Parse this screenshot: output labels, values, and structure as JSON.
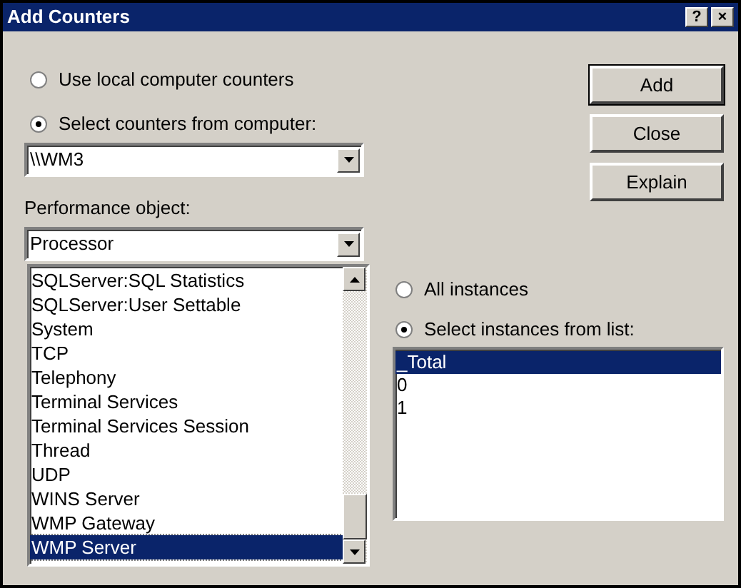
{
  "window": {
    "title": "Add Counters",
    "title_buttons": [
      "?",
      "×"
    ]
  },
  "source_options": [
    {
      "label": "Use local computer counters",
      "selected": false
    },
    {
      "label": "Select counters from computer:",
      "selected": true
    }
  ],
  "computer": {
    "value": "\\\\WM3"
  },
  "performance_object": {
    "label": "Performance object:",
    "value": "Processor"
  },
  "object_list": [
    {
      "label": "SQLServer:SQL Statistics",
      "selected": false
    },
    {
      "label": "SQLServer:User Settable",
      "selected": false
    },
    {
      "label": "System",
      "selected": false
    },
    {
      "label": "TCP",
      "selected": false
    },
    {
      "label": "Telephony",
      "selected": false
    },
    {
      "label": "Terminal Services",
      "selected": false
    },
    {
      "label": "Terminal Services Session",
      "selected": false
    },
    {
      "label": "Thread",
      "selected": false
    },
    {
      "label": "UDP",
      "selected": false
    },
    {
      "label": "WINS Server",
      "selected": false
    },
    {
      "label": "WMP Gateway",
      "selected": false
    },
    {
      "label": "WMP Server",
      "selected": true
    }
  ],
  "buttons": [
    {
      "label": "Add",
      "default": true
    },
    {
      "label": "Close",
      "default": false
    },
    {
      "label": "Explain",
      "default": false
    }
  ],
  "instance_options": [
    {
      "label": "All instances",
      "selected": false
    },
    {
      "label": "Select instances from list:",
      "selected": true
    }
  ],
  "instance_list": [
    {
      "label": "_Total",
      "selected": true
    },
    {
      "label": "0",
      "selected": false
    },
    {
      "label": "1",
      "selected": false
    }
  ]
}
